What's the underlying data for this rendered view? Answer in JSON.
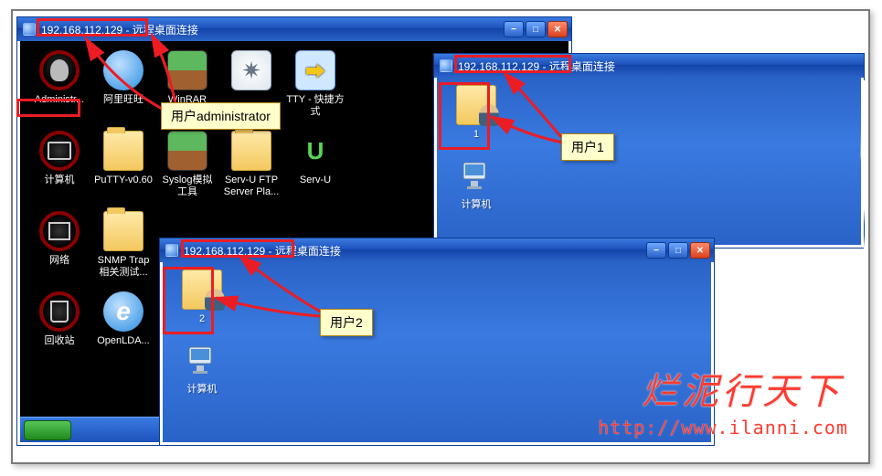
{
  "window_admin": {
    "ip": "192.168.112.129",
    "title_suffix": " - 远程桌面连接",
    "icons": [
      {
        "name": "administrator-icon",
        "label": "Administr...",
        "glyph": "admin"
      },
      {
        "name": "aliwangwang-icon",
        "label": "阿里旺旺",
        "glyph": "wangwang"
      },
      {
        "name": "winrar-icon",
        "label": "WinRAR",
        "glyph": "winrar"
      },
      {
        "name": "gear-icon",
        "label": "",
        "glyph": "gear"
      },
      {
        "name": "putty-shortcut-icon",
        "label": "TTY - 快捷方式",
        "glyph": "putty"
      },
      {
        "name": "",
        "label": "",
        "glyph": ""
      },
      {
        "name": "computer-icon",
        "label": "计算机",
        "glyph": "computer"
      },
      {
        "name": "putty-folder-icon",
        "label": "PuTTY-v0.60",
        "glyph": "folder"
      },
      {
        "name": "syslog-icon",
        "label": "Syslog模拟工具",
        "glyph": "winrar"
      },
      {
        "name": "servu-ftp-icon",
        "label": "Serv-U FTP Server Pla...",
        "glyph": "folder"
      },
      {
        "name": "servu-icon",
        "label": "Serv-U",
        "glyph": "utorrent"
      },
      {
        "name": "",
        "label": "",
        "glyph": ""
      },
      {
        "name": "network-icon",
        "label": "网络",
        "glyph": "network"
      },
      {
        "name": "snmp-trap-icon",
        "label": "SNMP Trap相关测试...",
        "glyph": "folder"
      },
      {
        "name": "",
        "label": "",
        "glyph": ""
      },
      {
        "name": "",
        "label": "",
        "glyph": ""
      },
      {
        "name": "",
        "label": "",
        "glyph": ""
      },
      {
        "name": "",
        "label": "",
        "glyph": ""
      },
      {
        "name": "recycle-bin-icon",
        "label": "回收站",
        "glyph": "recycle"
      },
      {
        "name": "openldap-icon",
        "label": "OpenLDA...",
        "glyph": "ie"
      }
    ]
  },
  "window_user1": {
    "ip": "192.168.112.129",
    "title_suffix": " - 远程桌面连接",
    "icons": [
      {
        "name": "user1-folder-icon",
        "label": "1",
        "glyph": "userfolder"
      },
      {
        "name": "computer-icon",
        "label": "计算机",
        "glyph": "pc"
      }
    ]
  },
  "window_user2": {
    "ip": "192.168.112.129",
    "title_suffix": " - 远程桌面连接",
    "icons": [
      {
        "name": "user2-folder-icon",
        "label": "2",
        "glyph": "userfolder"
      },
      {
        "name": "computer-icon",
        "label": "计算机",
        "glyph": "pc"
      }
    ]
  },
  "callouts": {
    "admin": "用户administrator",
    "user1": "用户1",
    "user2": "用户2"
  },
  "watermark": {
    "text": "烂泥行天下",
    "url": "http://www.ilanni.com"
  },
  "winbuttons": {
    "min": "−",
    "max": "□",
    "close": "✕"
  }
}
